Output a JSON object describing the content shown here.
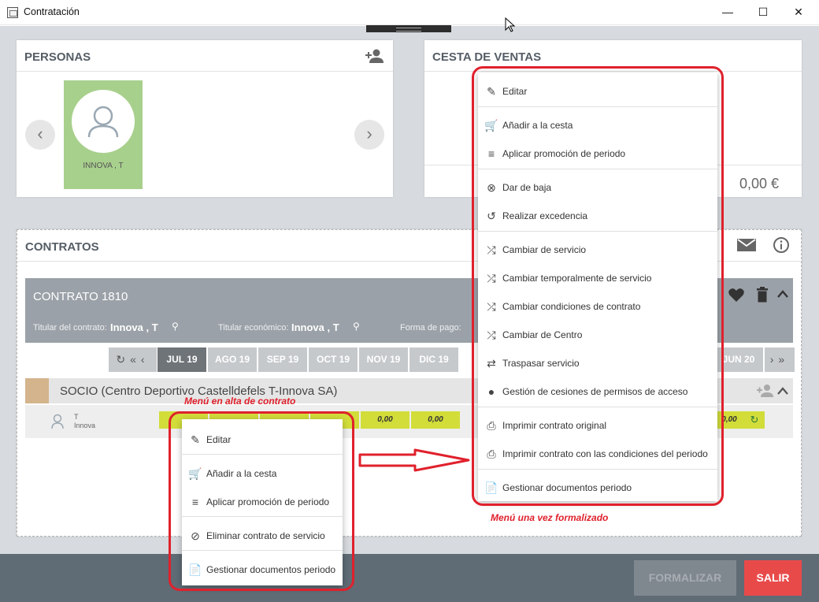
{
  "window": {
    "title": "Contratación",
    "minimize": "—",
    "maximize": "☐",
    "close": "✕"
  },
  "personas": {
    "title": "PERSONAS",
    "person_name": "INNOVA , T",
    "prev": "‹",
    "next": "›"
  },
  "cesta": {
    "title": "CESTA DE VENTAS",
    "total": "0,00 €"
  },
  "contratos": {
    "title": "CONTRATOS",
    "contract_title": "CONTRATO 1810",
    "titular_label": "Titular del contrato:",
    "titular_value": "Innova , T",
    "economico_label": "Titular económico:",
    "economico_value": "Innova , T",
    "pago_label": "Forma de pago:",
    "months": [
      "JUL 19",
      "AGO 19",
      "SEP 19",
      "OCT 19",
      "NOV 19",
      "DIC 19"
    ],
    "last_month": "JUN 20",
    "socio_label": "SOCIO (Centro Deportivo Castelldefels T-Innova SA)",
    "member_first": "T",
    "member_last": "Innova",
    "cell_values": [
      "0,00",
      "0,00"
    ],
    "right_cell_value": "0,00"
  },
  "left_menu": {
    "items": [
      {
        "label": "Editar",
        "icon": "pencil-icon"
      },
      {
        "label": "Añadir a la cesta",
        "icon": "cart-add-icon"
      },
      {
        "label": "Aplicar promoción de periodo",
        "icon": "playlist-add-icon"
      },
      {
        "label": "Eliminar contrato de servicio",
        "icon": "block-icon"
      },
      {
        "label": "Gestionar documentos periodo",
        "icon": "document-icon"
      }
    ]
  },
  "right_menu": {
    "items": [
      {
        "label": "Editar",
        "icon": "pencil-icon"
      },
      {
        "label": "Añadir a la cesta",
        "icon": "cart-add-icon"
      },
      {
        "label": "Aplicar promoción de periodo",
        "icon": "playlist-add-icon"
      },
      {
        "label": "Dar de baja",
        "icon": "cancel-circle-icon"
      },
      {
        "label": "Realizar excedencia",
        "icon": "history-icon"
      },
      {
        "label": "Cambiar de servicio",
        "icon": "shuffle-icon"
      },
      {
        "label": "Cambiar temporalmente de servicio",
        "icon": "shuffle-icon"
      },
      {
        "label": "Cambiar condiciones de contrato",
        "icon": "shuffle-icon"
      },
      {
        "label": "Cambiar de Centro",
        "icon": "shuffle-icon"
      },
      {
        "label": "Traspasar servicio",
        "icon": "swap-icon"
      },
      {
        "label": "Gestión de cesiones de permisos de acceso",
        "icon": "person-icon"
      },
      {
        "label": "Imprimir contrato original",
        "icon": "printer-icon"
      },
      {
        "label": "Imprimir contrato con las condiciones del periodo",
        "icon": "printer-icon"
      },
      {
        "label": "Gestionar documentos periodo",
        "icon": "document-icon"
      }
    ]
  },
  "annotations": {
    "left": "Menú en alta de contrato",
    "right": "Menú una vez formalizado"
  },
  "footer": {
    "formalizar": "FORMALIZAR",
    "salir": "SALIR"
  },
  "colors": {
    "accent_red": "#e0212c",
    "salir_button": "#e84a4a",
    "member_card": "#a8d08d",
    "cell_lime": "#d2dd3a"
  }
}
